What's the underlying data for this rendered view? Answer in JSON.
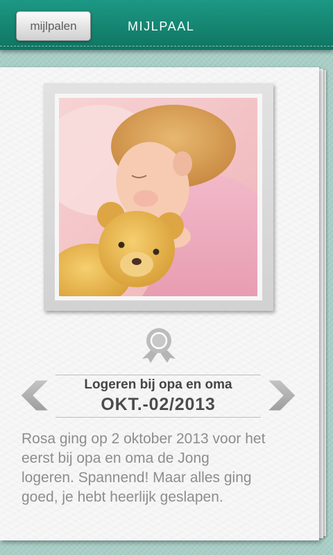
{
  "header": {
    "back_label": "mijlpalen",
    "title": "MIJLPAAL"
  },
  "milestone": {
    "title": "Logeren bij opa en oma",
    "date": "OKT.-02/2013",
    "description_lines": [
      "Rosa ging op 2 oktober 2013 voor het",
      "eerst bij opa en oma de Jong",
      "logeren. Spannend! Maar alles ging",
      "goed, je hebt heerlijk geslapen."
    ]
  },
  "icons": {
    "milestone": "award-ribbon-icon",
    "previous": "chevron-left-icon",
    "next": "chevron-right-icon"
  },
  "colors": {
    "header": "#13826e",
    "background": "#a8cec6",
    "card": "#f7f7f7",
    "title_text": "#454545",
    "body_text": "#8d8d8d",
    "icon_gray": "#b3b3b3"
  }
}
